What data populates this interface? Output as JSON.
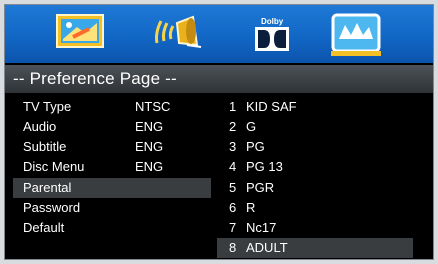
{
  "icons": [
    {
      "name": "general-setup-icon"
    },
    {
      "name": "audio-speaker-icon"
    },
    {
      "name": "dolby-icon",
      "label": "Dolby"
    },
    {
      "name": "preference-icon",
      "active": true
    }
  ],
  "title": "-- Preference Page --",
  "settings": [
    {
      "label": "TV Type",
      "value": "NTSC"
    },
    {
      "label": "Audio",
      "value": "ENG"
    },
    {
      "label": "Subtitle",
      "value": "ENG"
    },
    {
      "label": "Disc Menu",
      "value": "ENG"
    },
    {
      "label": "Parental",
      "value": ""
    },
    {
      "label": "Password",
      "value": ""
    },
    {
      "label": "Default",
      "value": ""
    }
  ],
  "parental_options": [
    {
      "num": "1",
      "text": "KID SAF"
    },
    {
      "num": "2",
      "text": "G"
    },
    {
      "num": "3",
      "text": "PG"
    },
    {
      "num": "4",
      "text": "PG 13"
    },
    {
      "num": "5",
      "text": "PGR"
    },
    {
      "num": "6",
      "text": "R"
    },
    {
      "num": "7",
      "text": "Nc17"
    },
    {
      "num": "8",
      "text": "ADULT"
    }
  ],
  "selected_setting": "Parental",
  "selected_option": "8 ADULT"
}
